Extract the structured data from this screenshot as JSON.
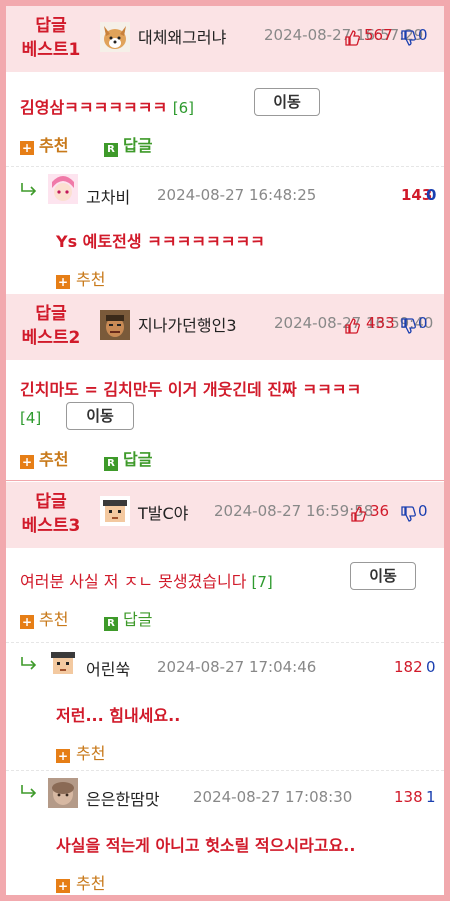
{
  "best1": {
    "label_line1": "답글",
    "label_line2": "베스트1",
    "nick": "대체왜그러냐",
    "date": "2024-08-27 16:57:29",
    "up": "567",
    "down": "0",
    "title": "김영삼ㅋㅋㅋㅋㅋㅋㅋ",
    "count": "[6]",
    "move": "이동",
    "recommend": "추천",
    "reply": "답글",
    "replies": [
      {
        "nick": "고차비",
        "date": "2024-08-27 16:48:25",
        "up": "143",
        "down": "0",
        "text": "Ys 예토전생 ㅋㅋㅋㅋㅋㅋㅋㅋ",
        "recommend": "추천"
      }
    ]
  },
  "best2": {
    "label_line1": "답글",
    "label_line2": "베스트2",
    "nick": "지나가던행인3",
    "date": "2024-08-27 16:59:40",
    "up": "433",
    "down": "0",
    "title_line1": "긴치마도 = 김치만두 이거 개웃긴데 진짜 ㅋㅋㅋㅋ",
    "count": "[4]",
    "move": "이동",
    "recommend": "추천",
    "reply": "답글"
  },
  "best3": {
    "label_line1": "답글",
    "label_line2": "베스트3",
    "nick": "T발C야",
    "date": "2024-08-27 16:59:58",
    "up": "36",
    "down": "0",
    "title": "여러분 사실 저 ㅈㄴ 못생겼습니다",
    "count": "[7]",
    "move": "이동",
    "recommend": "추천",
    "reply": "답글",
    "replies": [
      {
        "nick": "어린쑥",
        "date": "2024-08-27 17:04:46",
        "up": "182",
        "down": "0",
        "text": "저런... 힘내세요..",
        "recommend": "추천"
      },
      {
        "nick": "은은한땀맛",
        "date": "2024-08-27 17:08:30",
        "up": "138",
        "down": "1",
        "text": "사실을 적는게 아니고 헛소릴 적으시라고요..",
        "recommend": "추천"
      }
    ]
  },
  "icons": {
    "thumb_up": "thumbs-up-icon",
    "thumb_down": "thumbs-down-icon",
    "reply_arrow": "reply-arrow-icon"
  },
  "colors": {
    "accent_red": "#d11a2a",
    "accent_blue": "#1a3fb0",
    "best_bg": "#fbe3e5",
    "border_pink": "#f2a9ae"
  }
}
